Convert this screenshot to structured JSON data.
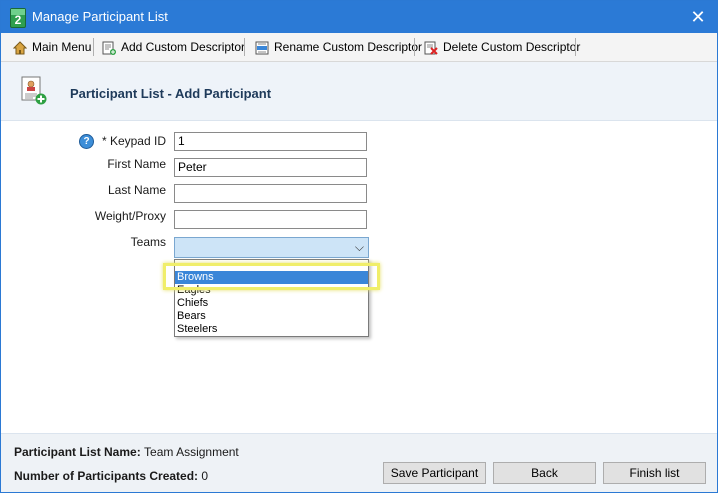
{
  "window": {
    "title": "Manage Participant List",
    "app_icon_label": "2"
  },
  "toolbar": {
    "main_menu": "Main Menu",
    "add_descriptor": "Add Custom Descriptor",
    "rename_descriptor": "Rename Custom Descriptor",
    "delete_descriptor": "Delete Custom Descriptor"
  },
  "header": {
    "title": "Participant List - Add Participant"
  },
  "form": {
    "keypad_label": "* Keypad ID",
    "keypad_value": "1",
    "first_name_label": "First Name",
    "first_name_value": "Peter",
    "last_name_label": "Last Name",
    "last_name_value": "",
    "weight_label": "Weight/Proxy",
    "weight_value": "",
    "teams_label": "Teams",
    "teams_value": "",
    "teams_options": [
      "Browns",
      "Eagles",
      "Chiefs",
      "Bears",
      "Steelers"
    ],
    "teams_highlighted": "Browns"
  },
  "footer": {
    "list_name_label": "Participant List Name:",
    "list_name_value": "Team Assignment",
    "count_label": "Number of Participants Created:",
    "count_value": "0",
    "save_button": "Save Participant",
    "back_button": "Back",
    "finish_button": "Finish list"
  },
  "colors": {
    "titlebar": "#2b7ad6",
    "highlight": "#f0ee6a",
    "selected_option": "#3a86d8"
  }
}
